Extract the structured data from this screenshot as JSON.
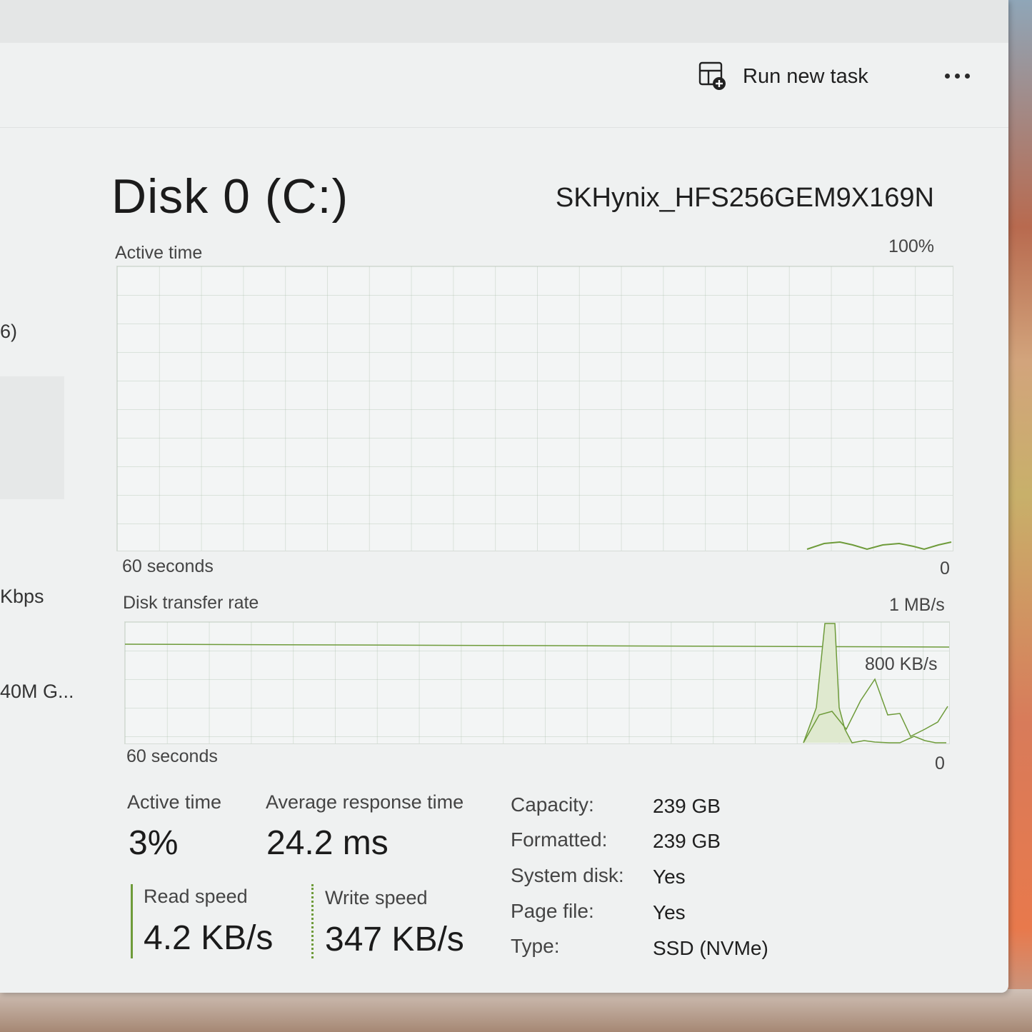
{
  "toolbar": {
    "run_task_label": "Run new task",
    "more_label": "More options"
  },
  "sidebar_fragments": {
    "percent": "6)",
    "network": "Kbps",
    "gpu": "40M G..."
  },
  "disk": {
    "title": "Disk 0 (C:)",
    "model": "SKHynix_HFS256GEM9X169N"
  },
  "active_graph": {
    "label": "Active time",
    "max_label": "100%",
    "time_label": "60 seconds",
    "min_label": "0"
  },
  "transfer_graph": {
    "label": "Disk transfer rate",
    "max_label": "1 MB/s",
    "mid_label": "800 KB/s",
    "time_label": "60 seconds",
    "min_label": "0"
  },
  "stats": {
    "active_time_label": "Active time",
    "active_time_value": "3%",
    "avg_response_label": "Average response time",
    "avg_response_value": "24.2 ms",
    "read_speed_label": "Read speed",
    "read_speed_value": "4.2 KB/s",
    "write_speed_label": "Write speed",
    "write_speed_value": "347 KB/s"
  },
  "info": [
    {
      "label": "Capacity:",
      "value": "239 GB"
    },
    {
      "label": "Formatted:",
      "value": "239 GB"
    },
    {
      "label": "System disk:",
      "value": "Yes"
    },
    {
      "label": "Page file:",
      "value": "Yes"
    },
    {
      "label": "Type:",
      "value": "SSD (NVMe)"
    }
  ],
  "colors": {
    "graph_line": "#6e9b3a",
    "graph_fill": "#dfe9cf"
  }
}
